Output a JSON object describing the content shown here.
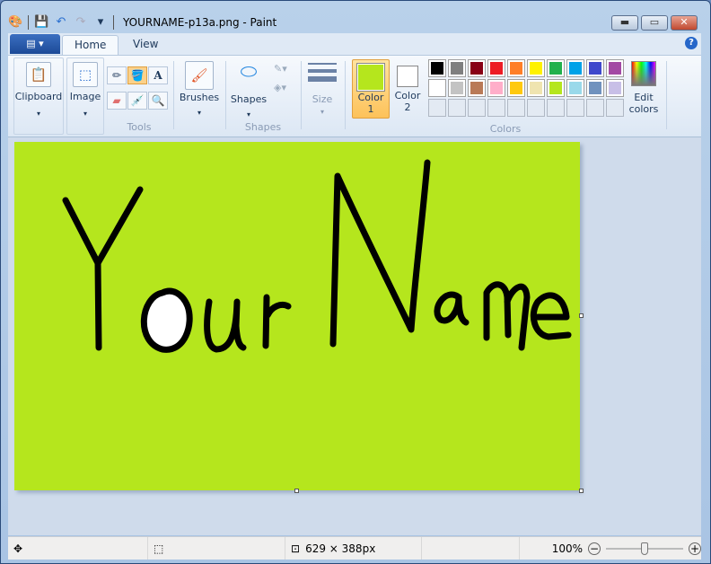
{
  "window": {
    "title": "YOURNAME-p13a.png - Paint"
  },
  "tabs": [
    {
      "label": "Home"
    },
    {
      "label": "View"
    }
  ],
  "ribbon": {
    "clipboard": "Clipboard",
    "image": "Image",
    "tools": "Tools",
    "brushes": "Brushes",
    "shapes_btn": "Shapes",
    "shapes_group": "Shapes",
    "size": "Size",
    "color1": "Color",
    "color1_num": "1",
    "color2": "Color",
    "color2_num": "2",
    "edit_colors_1": "Edit",
    "edit_colors_2": "colors",
    "colors_group": "Colors",
    "color1_value": "#b5e61d",
    "color2_value": "#ffffff",
    "palette": [
      "#000000",
      "#7f7f7f",
      "#880015",
      "#ed1c24",
      "#ff7f27",
      "#fff200",
      "#22b14c",
      "#00a2e8",
      "#3f48cc",
      "#a349a4",
      "#ffffff",
      "#c3c3c3",
      "#b97a57",
      "#ffaec9",
      "#ffc90e",
      "#efe4b0",
      "#b5e61d",
      "#99d9ea",
      "#7092be",
      "#c8bfe7"
    ]
  },
  "canvas": {
    "background": "#b5e61d",
    "drawn_text": "Your Name"
  },
  "status": {
    "size": "629 × 388px",
    "zoom": "100%",
    "zoom_level": 100
  }
}
